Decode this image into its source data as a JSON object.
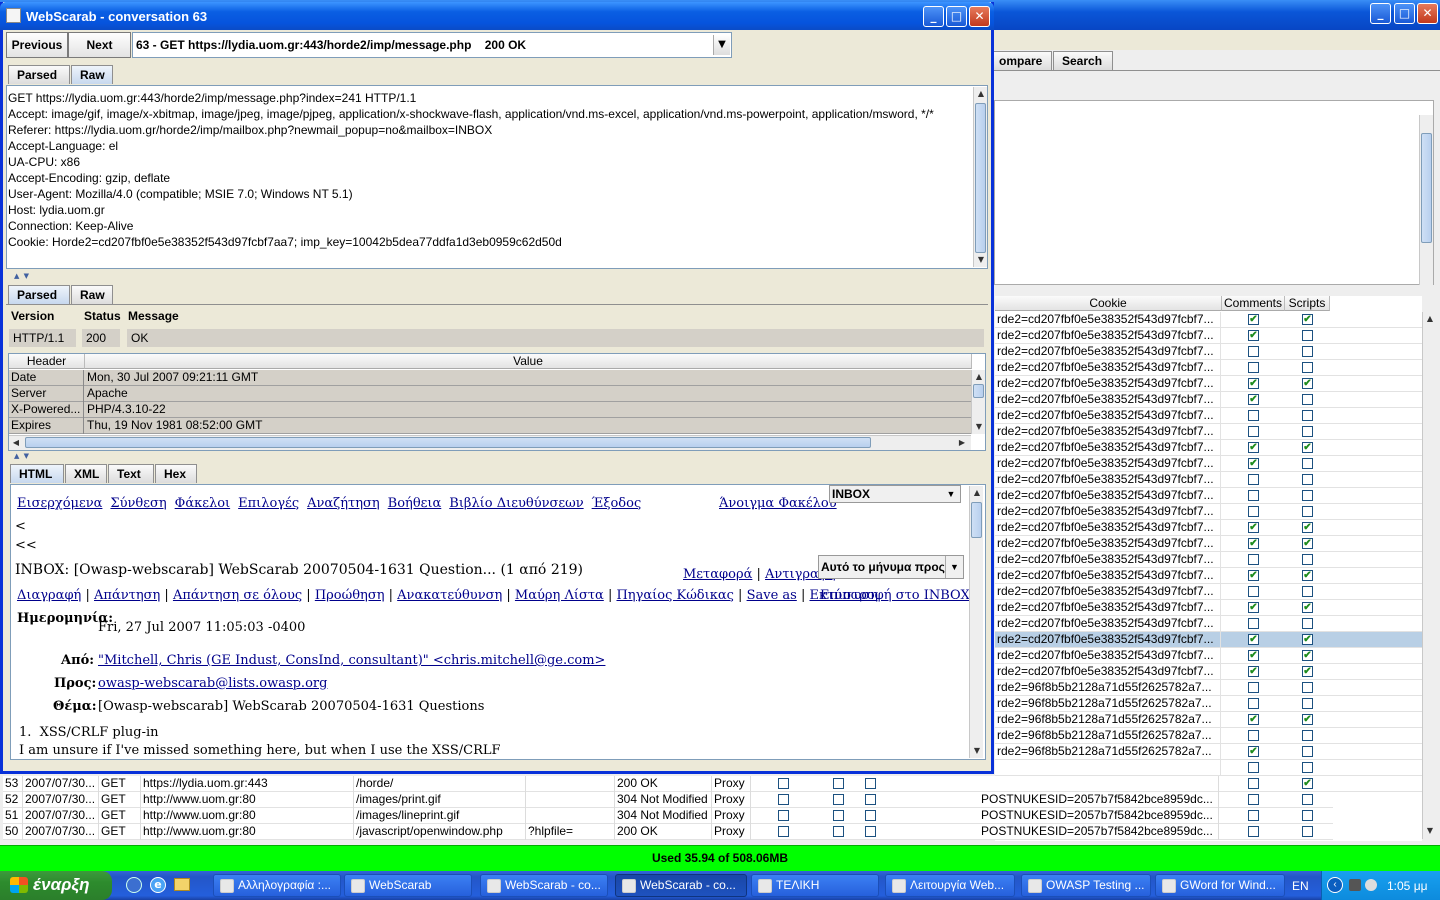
{
  "background_window": {
    "tabs": [
      "ompare",
      "Search"
    ],
    "table_headers": [
      "Cookie",
      "Comments",
      "Scripts"
    ],
    "rows": [
      {
        "cookie": "rde2=cd207fbf0e5e38352f543d97fcbf7...",
        "comments": true,
        "scripts": true
      },
      {
        "cookie": "rde2=cd207fbf0e5e38352f543d97fcbf7...",
        "comments": true,
        "scripts": false
      },
      {
        "cookie": "rde2=cd207fbf0e5e38352f543d97fcbf7...",
        "comments": false,
        "scripts": false
      },
      {
        "cookie": "rde2=cd207fbf0e5e38352f543d97fcbf7...",
        "comments": false,
        "scripts": false
      },
      {
        "cookie": "rde2=cd207fbf0e5e38352f543d97fcbf7...",
        "comments": true,
        "scripts": true
      },
      {
        "cookie": "rde2=cd207fbf0e5e38352f543d97fcbf7...",
        "comments": true,
        "scripts": false
      },
      {
        "cookie": "rde2=cd207fbf0e5e38352f543d97fcbf7...",
        "comments": false,
        "scripts": false
      },
      {
        "cookie": "rde2=cd207fbf0e5e38352f543d97fcbf7...",
        "comments": false,
        "scripts": false
      },
      {
        "cookie": "rde2=cd207fbf0e5e38352f543d97fcbf7...",
        "comments": true,
        "scripts": true
      },
      {
        "cookie": "rde2=cd207fbf0e5e38352f543d97fcbf7...",
        "comments": true,
        "scripts": false
      },
      {
        "cookie": "rde2=cd207fbf0e5e38352f543d97fcbf7...",
        "comments": false,
        "scripts": false
      },
      {
        "cookie": "rde2=cd207fbf0e5e38352f543d97fcbf7...",
        "comments": false,
        "scripts": false
      },
      {
        "cookie": "rde2=cd207fbf0e5e38352f543d97fcbf7...",
        "comments": false,
        "scripts": false
      },
      {
        "cookie": "rde2=cd207fbf0e5e38352f543d97fcbf7...",
        "comments": true,
        "scripts": true
      },
      {
        "cookie": "rde2=cd207fbf0e5e38352f543d97fcbf7...",
        "comments": true,
        "scripts": true
      },
      {
        "cookie": "rde2=cd207fbf0e5e38352f543d97fcbf7...",
        "comments": false,
        "scripts": false
      },
      {
        "cookie": "rde2=cd207fbf0e5e38352f543d97fcbf7...",
        "comments": true,
        "scripts": true
      },
      {
        "cookie": "rde2=cd207fbf0e5e38352f543d97fcbf7...",
        "comments": false,
        "scripts": false
      },
      {
        "cookie": "rde2=cd207fbf0e5e38352f543d97fcbf7...",
        "comments": true,
        "scripts": true
      },
      {
        "cookie": "rde2=cd207fbf0e5e38352f543d97fcbf7...",
        "comments": false,
        "scripts": false
      },
      {
        "cookie": "rde2=cd207fbf0e5e38352f543d97fcbf7...",
        "comments": true,
        "scripts": true,
        "selected": true
      },
      {
        "cookie": "rde2=cd207fbf0e5e38352f543d97fcbf7...",
        "comments": true,
        "scripts": true
      },
      {
        "cookie": "rde2=cd207fbf0e5e38352f543d97fcbf7...",
        "comments": true,
        "scripts": true
      },
      {
        "cookie": "rde2=96f8b5b2128a71d55f2625782a7...",
        "comments": false,
        "scripts": false
      },
      {
        "cookie": "rde2=96f8b5b2128a71d55f2625782a7...",
        "comments": false,
        "scripts": false
      },
      {
        "cookie": "rde2=96f8b5b2128a71d55f2625782a7...",
        "comments": true,
        "scripts": true
      },
      {
        "cookie": "rde2=96f8b5b2128a71d55f2625782a7...",
        "comments": false,
        "scripts": false
      },
      {
        "cookie": "rde2=96f8b5b2128a71d55f2625782a7...",
        "comments": true,
        "scripts": false
      },
      {
        "cookie": "",
        "comments": false,
        "scripts": false
      },
      {
        "cookie": "",
        "comments": false,
        "scripts": true
      }
    ],
    "lower_rows": [
      {
        "id": "53",
        "date": "2007/07/30...",
        "method": "GET",
        "host": "https://lydia.uom.gr:443",
        "path": "/horde/",
        "params": "",
        "status": "200 OK",
        "origin": "Proxy",
        "cookie": "",
        "comments": false,
        "scripts": true
      },
      {
        "id": "52",
        "date": "2007/07/30...",
        "method": "GET",
        "host": "http://www.uom.gr:80",
        "path": "/images/print.gif",
        "params": "",
        "status": "304 Not Modified",
        "origin": "Proxy",
        "cookie": "POSTNUKESID=2057b7f5842bce8959dc...",
        "comments": false,
        "scripts": false
      },
      {
        "id": "51",
        "date": "2007/07/30...",
        "method": "GET",
        "host": "http://www.uom.gr:80",
        "path": "/images/lineprint.gif",
        "params": "",
        "status": "304 Not Modified",
        "origin": "Proxy",
        "cookie": "POSTNUKESID=2057b7f5842bce8959dc...",
        "comments": false,
        "scripts": false
      },
      {
        "id": "50",
        "date": "2007/07/30...",
        "method": "GET",
        "host": "http://www.uom.gr:80",
        "path": "/javascript/openwindow.php",
        "params": "?hlpfile=",
        "status": "200 OK",
        "origin": "Proxy",
        "cookie": "POSTNUKESID=2057b7f5842bce8959dc...",
        "comments": false,
        "scripts": false
      }
    ]
  },
  "conversation_window": {
    "title": "WebScarab - conversation 63",
    "previous_label": "Previous",
    "next_label": "Next",
    "conversation_select": "63 - GET https://lydia.uom.gr:443/horde2/imp/message.php    200 OK",
    "request_tabs": [
      "Parsed",
      "Raw"
    ],
    "request_raw_lines": [
      "GET https://lydia.uom.gr:443/horde2/imp/message.php?index=241 HTTP/1.1",
      "Accept: image/gif, image/x-xbitmap, image/jpeg, image/pjpeg, application/x-shockwave-flash, application/vnd.ms-excel, application/vnd.ms-powerpoint, application/msword, */*",
      "Referer: https://lydia.uom.gr/horde2/imp/mailbox.php?newmail_popup=no&mailbox=INBOX",
      "Accept-Language: el",
      "UA-CPU: x86",
      "Accept-Encoding: gzip, deflate",
      "User-Agent: Mozilla/4.0 (compatible; MSIE 7.0; Windows NT 5.1)",
      "Host: lydia.uom.gr",
      "Connection: Keep-Alive",
      "Cookie: Horde2=cd207fbf0e5e38352f543d97fcbf7aa7; imp_key=10042b5dea77ddfa1d3eb0959c62d50d"
    ],
    "response_tabs": [
      "Parsed",
      "Raw"
    ],
    "response_fields": {
      "version_label": "Version",
      "status_label": "Status",
      "message_label": "Message",
      "version": "HTTP/1.1",
      "status": "200",
      "message": "OK"
    },
    "header_columns": [
      "Header",
      "Value"
    ],
    "headers": [
      {
        "name": "Date",
        "value": "Mon, 30 Jul 2007 09:21:11 GMT"
      },
      {
        "name": "Server",
        "value": "Apache"
      },
      {
        "name": "X-Powered...",
        "value": "PHP/4.3.10-22"
      },
      {
        "name": "Expires",
        "value": "Thu, 19 Nov 1981 08:52:00 GMT"
      }
    ],
    "content_tabs": [
      "HTML",
      "XML",
      "Text",
      "Hex"
    ],
    "html_view": {
      "menu_links": [
        "Εισερχόμενα",
        "Σύνθεση",
        "Φάκελοι",
        "Επιλογές",
        "Αναζήτηση",
        "Βοήθεια",
        "Βιβλίο Διευθύνσεων",
        "Έξοδος"
      ],
      "open_folder_link": "Άνοιγμα Φακέλου",
      "folder_select": "INBOX",
      "nav_prev": "<",
      "nav_first": "<<",
      "message_heading": "INBOX: [Owasp-webscarab] WebScarab 20070504-1631 Question... (1 από 219)",
      "move_link": "Μεταφορά",
      "copy_link": "Αντιγραφή",
      "target_select": "Αυτό το μήνυμα προς",
      "action_links": [
        "Διαγραφή",
        "Απάντηση",
        "Απάντηση σε όλους",
        "Προώθηση",
        "Ανακατεύθυνση",
        "Μαύρη Λίστα",
        "Πηγαίος Κώδικας",
        "Save as",
        "Εκτύπωση"
      ],
      "back_link": "Επιστροφή στο INBOX",
      "date_label": "Ημερομηνία:",
      "date_value": "Fri, 27 Jul 2007 11:05:03 -0400",
      "from_label": "Από:",
      "from_value": "\"Mitchell, Chris (GE Indust, ConsInd, consultant)\" <chris.mitchell@ge.com>",
      "to_label": "Προς:",
      "to_value": "owasp-webscarab@lists.owasp.org",
      "subject_label": "Θέμα:",
      "subject_value": "[Owasp-webscarab] WebScarab 20070504-1631 Questions",
      "body_item": "1.  XSS/CRLF plug-in",
      "body_line": "I am unsure if I've missed something here, but when I use the XSS/CRLF"
    }
  },
  "memory_bar": "Used 35.94 of 508.06MB",
  "taskbar": {
    "start_label": "έναρξη",
    "buttons": [
      {
        "label": "Αλληλογραφία :...",
        "active": false
      },
      {
        "label": "WebScarab",
        "active": false
      },
      {
        "label": "WebScarab - co...",
        "active": false
      },
      {
        "label": "WebScarab - co...",
        "active": true
      },
      {
        "label": "ΤΕΛΙΚΗ",
        "active": false
      },
      {
        "label": "Λειτουργία Web...",
        "active": false
      },
      {
        "label": "OWASP Testing ...",
        "active": false
      },
      {
        "label": "GWord for Wind...",
        "active": false
      }
    ],
    "language": "EN",
    "clock": "1:05 μμ"
  },
  "colors": {
    "titlebar": "#0a5fe3",
    "membar": "#00ff00",
    "taskbar": "#245fdc",
    "start": "#2d8b2d",
    "link": "#00008b"
  }
}
